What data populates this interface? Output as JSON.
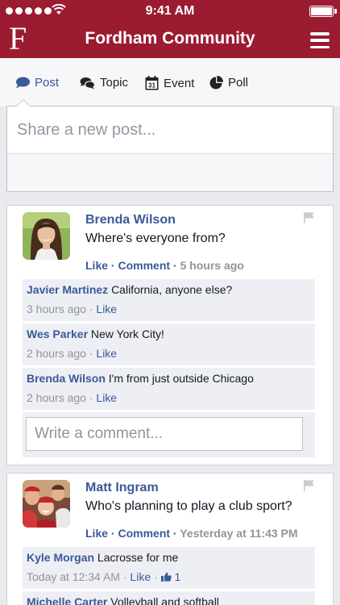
{
  "status_bar": {
    "time": "9:41 AM"
  },
  "nav": {
    "logo": "F",
    "title": "Fordham Community"
  },
  "composer": {
    "tabs": [
      {
        "label": "Post",
        "icon": "speech-bubble-icon"
      },
      {
        "label": "Topic",
        "icon": "chat-bubbles-icon"
      },
      {
        "label": "Event",
        "icon": "calendar-icon",
        "icon_text": "31"
      },
      {
        "label": "Poll",
        "icon": "pie-chart-icon"
      }
    ],
    "active_tab": "Post",
    "placeholder": "Share a new post..."
  },
  "posts": [
    {
      "author": "Brenda Wilson",
      "text": "Where's everyone from?",
      "like_label": "Like",
      "comment_label": "Comment",
      "time": "5 hours ago",
      "comments": [
        {
          "author": "Javier Martinez",
          "text": "California, anyone else?",
          "time": "3 hours ago",
          "like_label": "Like"
        },
        {
          "author": "Wes Parker",
          "text": "New York City!",
          "time": "2 hours ago",
          "like_label": "Like"
        },
        {
          "author": "Brenda Wilson",
          "text": "I'm from just outside Chicago",
          "time": "2 hours ago",
          "like_label": "Like"
        }
      ],
      "comment_placeholder": "Write a comment..."
    },
    {
      "author": "Matt Ingram",
      "text": "Who's planning to play a club sport?",
      "like_label": "Like",
      "comment_label": "Comment",
      "time": "Yesterday at 11:43 PM",
      "comments": [
        {
          "author": "Kyle Morgan",
          "text": "Lacrosse for me",
          "time": "Today at 12:34 AM",
          "like_label": "Like",
          "like_count": "1"
        },
        {
          "author": "Michelle Carter",
          "text": "Volleyball and softball"
        }
      ]
    }
  ],
  "colors": {
    "brand": "#9b1b30",
    "link": "#3b5998",
    "background": "#e9eaed"
  }
}
